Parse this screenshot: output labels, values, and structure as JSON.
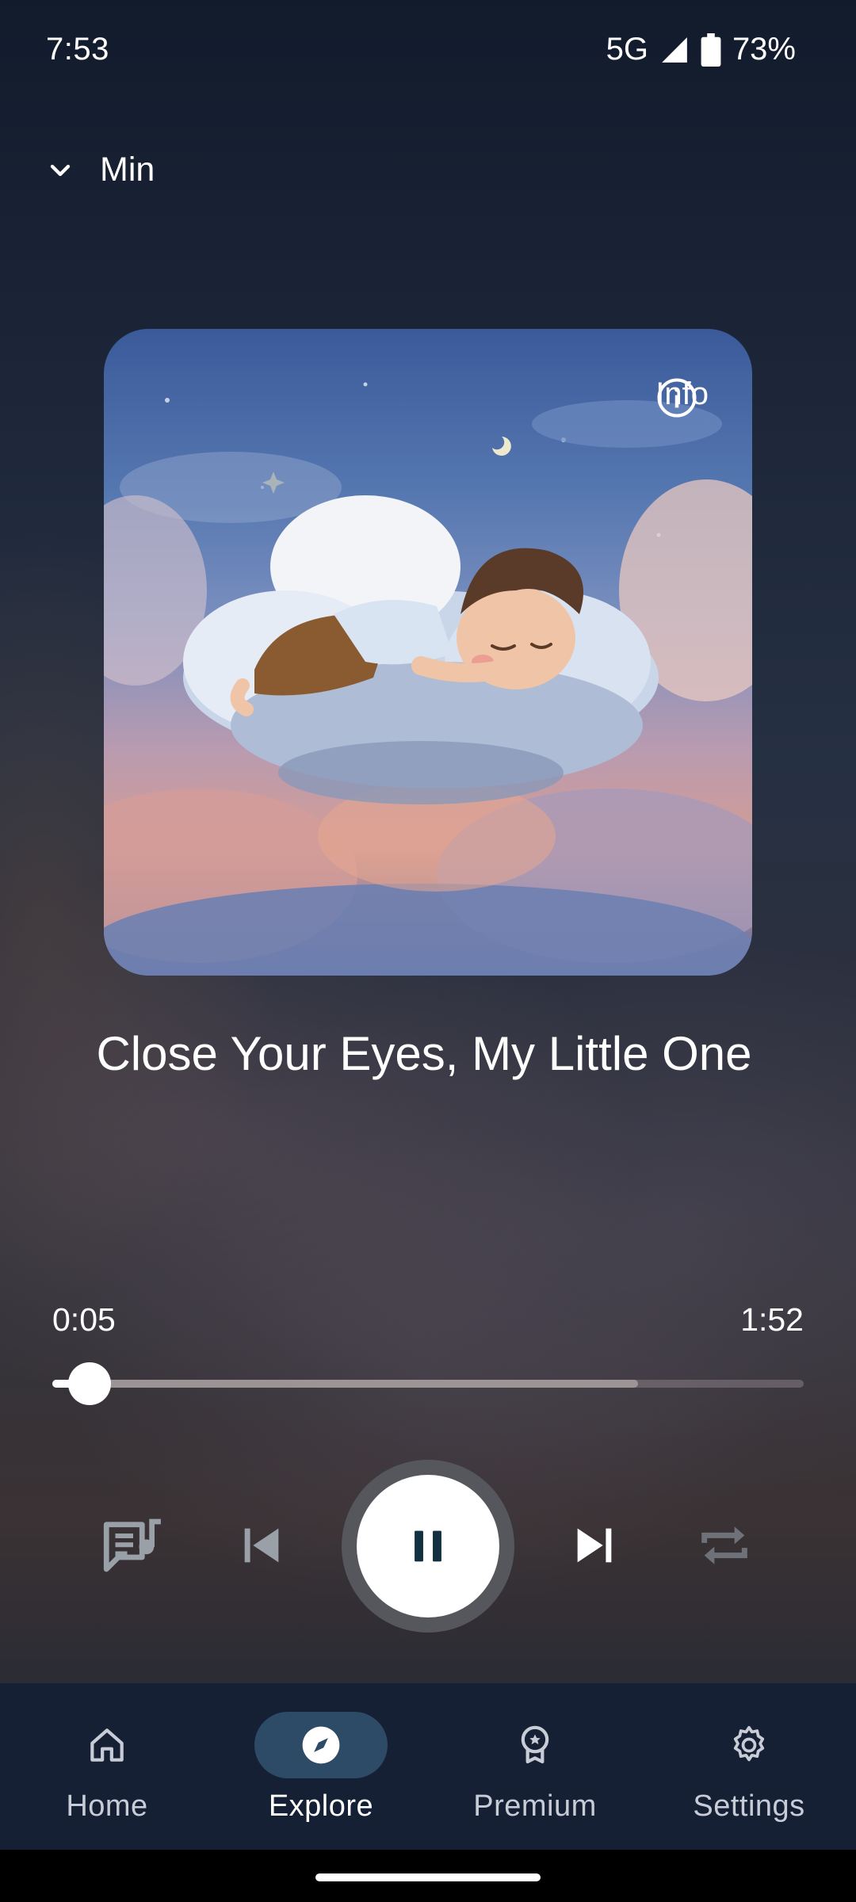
{
  "status_bar": {
    "time": "7:53",
    "network": "5G",
    "battery": "73%",
    "icons": [
      "signal-icon",
      "battery-icon"
    ]
  },
  "header": {
    "minimize_label": "Min",
    "minimize_icon": "chevron-down-icon"
  },
  "artwork": {
    "info_label": "Info",
    "info_icon": "info-icon"
  },
  "track": {
    "title": "Close Your Eyes, My Little One",
    "current_time": "0:05",
    "total_time": "1:52",
    "progress_fraction": 0.05,
    "buffered_fraction": 0.78
  },
  "controls": {
    "icons": [
      "lyrics-icon",
      "skip-previous-icon",
      "pause-icon",
      "skip-next-icon",
      "repeat-icon"
    ],
    "state": "playing"
  },
  "bottom_nav": {
    "items": [
      {
        "label": "Home",
        "icon": "home-icon",
        "active": false
      },
      {
        "label": "Explore",
        "icon": "compass-icon",
        "active": true
      },
      {
        "label": "Premium",
        "icon": "premium-badge-icon",
        "active": false
      },
      {
        "label": "Settings",
        "icon": "gear-icon",
        "active": false
      }
    ]
  },
  "colors": {
    "nav_background": "#152035",
    "nav_active_pill": "#2d4a66",
    "play_button_ring": "#55575c",
    "progress_played": "#ffffff"
  }
}
